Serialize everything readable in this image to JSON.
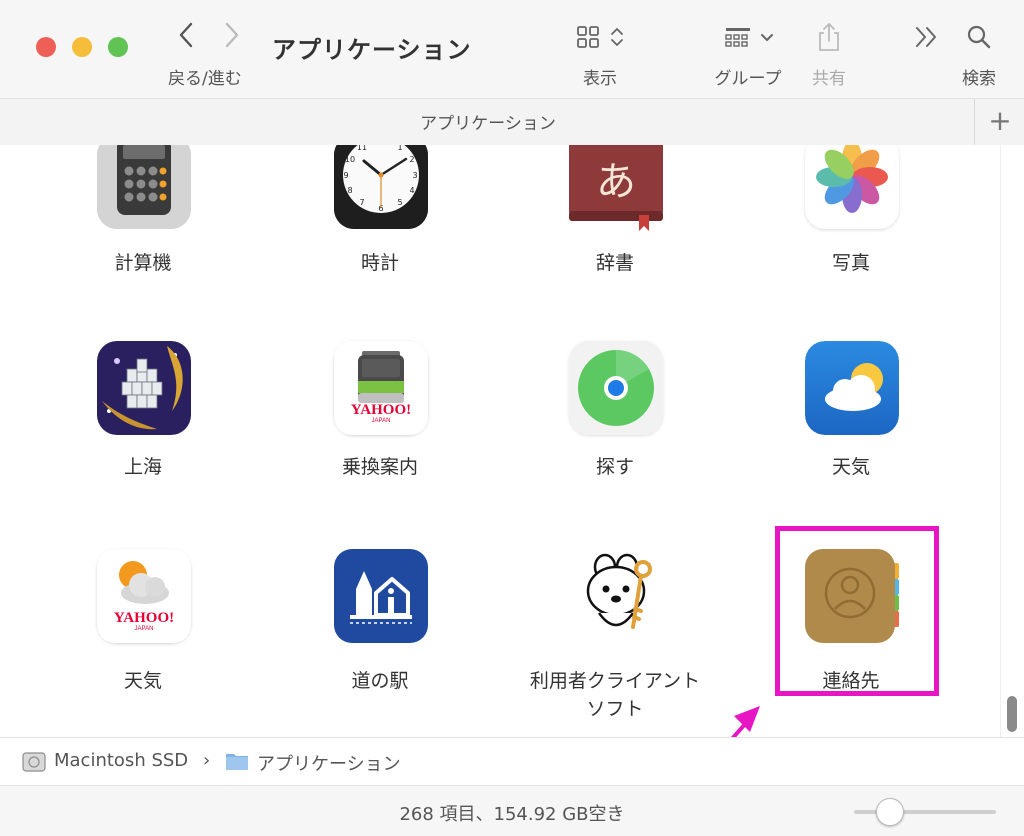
{
  "window": {
    "title": "アプリケーション",
    "nav_label": "戻る/進む",
    "toolbar": {
      "view_label": "表示",
      "group_label": "グループ",
      "share_label": "共有",
      "search_label": "検索"
    },
    "tab_title": "アプリケーション"
  },
  "apps": [
    {
      "label": "計算機",
      "icon": "calculator-icon"
    },
    {
      "label": "時計",
      "icon": "clock-icon"
    },
    {
      "label": "辞書",
      "icon": "dictionary-icon"
    },
    {
      "label": "写真",
      "icon": "photos-icon"
    },
    {
      "label": "上海",
      "icon": "shanghai-icon"
    },
    {
      "label": "乗換案内",
      "icon": "transit-icon"
    },
    {
      "label": "探す",
      "icon": "findmy-icon"
    },
    {
      "label": "天気",
      "icon": "weather-icon"
    },
    {
      "label": "天気",
      "icon": "yahoo-weather-icon"
    },
    {
      "label": "道の駅",
      "icon": "michinoeki-icon"
    },
    {
      "label": "利用者クライアントソフト",
      "label_line1": "利用者クライアント",
      "label_line2": "ソフト",
      "icon": "etax-client-icon"
    },
    {
      "label": "連絡先",
      "icon": "contacts-icon"
    }
  ],
  "icon_text": {
    "dictionary_glyph": "あ",
    "yahoo": "YAHOO!",
    "japan": "JAPAN"
  },
  "pathbar": {
    "disk": "Macintosh SSD",
    "separator": "›",
    "folder": "アプリケーション"
  },
  "status": {
    "text": "268 項目、154.92 GB空き"
  },
  "colors": {
    "highlight": "#e815c4",
    "arrow": "#e815c4"
  }
}
